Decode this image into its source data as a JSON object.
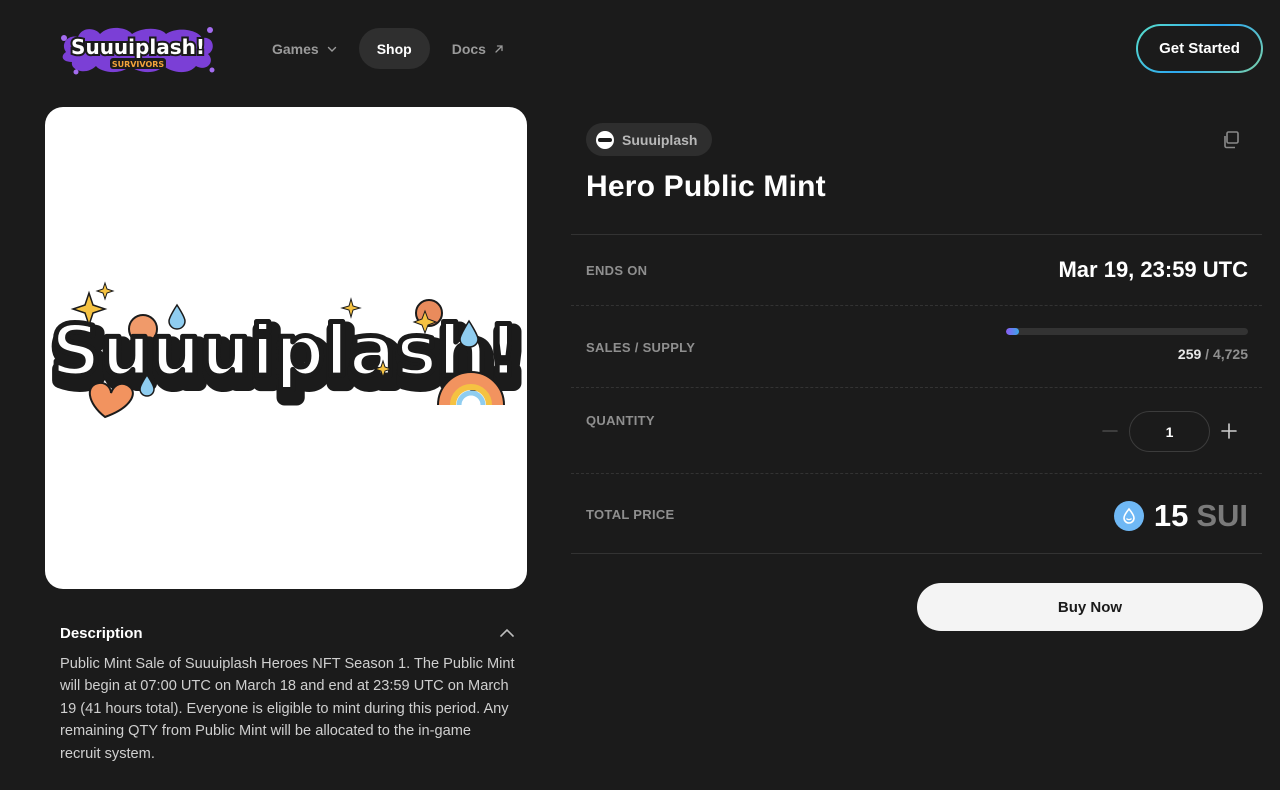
{
  "header": {
    "logo": {
      "name": "Suuuiplash!",
      "subtitle": "SURVIVORS"
    },
    "nav": [
      {
        "label": "Games",
        "icon": "chevron-down-icon"
      },
      {
        "label": "Shop",
        "active": true
      },
      {
        "label": "Docs",
        "icon": "external-link-icon"
      }
    ],
    "cta_label": "Get Started"
  },
  "hero": {
    "image_wordmark": "Suuuiplash!"
  },
  "description": {
    "title": "Description",
    "text": "Public Mint Sale of Suuuiplash Heroes NFT Season 1. The Public Mint will begin at 07:00 UTC on March 18 and end at 23:59 UTC on March 19 (41 hours total). Everyone is eligible to mint during this period. Any remaining QTY from Public Mint will be allocated to the in-game recruit system.",
    "toggle_icon": "chevron-up-icon"
  },
  "item": {
    "creator": "Suuuiplash",
    "title": "Hero Public Mint",
    "ends_on_label": "ENDS ON",
    "ends_on_value": "Mar 19, 23:59 UTC",
    "sales_supply_label": "SALES / SUPPLY",
    "sales": "259",
    "supply": "/ 4,725",
    "sales_fraction": 0.0548,
    "quantity_label": "QUANTITY",
    "quantity_value": "1",
    "total_price_label": "TOTAL PRICE",
    "price_amount": "15",
    "price_currency": "SUI",
    "buy_label": "Buy Now"
  },
  "colors": {
    "background": "#1b1b1b",
    "progress_start": "#8b5cf6",
    "progress_end": "#3ba6e8",
    "sui_blue": "#6fb8f5"
  }
}
